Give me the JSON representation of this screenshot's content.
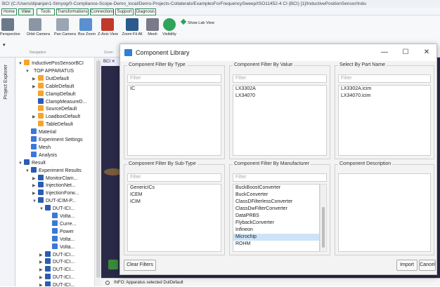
{
  "window_title": "BCI (C:/Users/dipanjan1-Simyog/0-Compliance-Scope-Demo_local/Demo-Projects-Collaterals/ExamplesForFrequencySweep/ISO11452-4 CI (BCI) [1]/InductivePositionSensor/Indu",
  "ribbon_tabs": [
    "Home",
    "View",
    "Tools",
    "Transformations",
    "Connections",
    "Support",
    "Diagnosis"
  ],
  "ribbon_buttons": [
    "Perspective",
    "Orbit Camera",
    "Pan Camera",
    "Box Zoom",
    "Z-Axis View",
    "Zoom Fit All",
    "Mesh",
    "Visibility"
  ],
  "show_lab_view": "Show Lab View",
  "ribbon_sections": {
    "navigation": "Navigation",
    "zoom": "Zoom"
  },
  "left_strip_label": "Project Explorer",
  "tree": [
    {
      "label": "InductivePosSensorBCI",
      "toggle": "▼",
      "icon": "iP"
    },
    {
      "label": "TOP APPARATUS",
      "toggle": "▼",
      "icon": ""
    },
    {
      "label": "DutDefault",
      "toggle": "▶",
      "icon": "iP"
    },
    {
      "label": "CableDefault",
      "toggle": "▶",
      "icon": "iP"
    },
    {
      "label": "ClampDefault",
      "toggle": "",
      "icon": "iP"
    },
    {
      "label": "ClampMeasureD...",
      "toggle": "",
      "icon": "iD"
    },
    {
      "label": "SourceDefault",
      "toggle": "",
      "icon": "iP"
    },
    {
      "label": "LoadboxDefault",
      "toggle": "▶",
      "icon": "iP"
    },
    {
      "label": "TableDefault",
      "toggle": "",
      "icon": "iP"
    },
    {
      "label": "Material",
      "toggle": "",
      "icon": "iV"
    },
    {
      "label": "Experiment Settings",
      "toggle": "",
      "icon": "iV"
    },
    {
      "label": "Mesh",
      "toggle": "",
      "icon": "iV"
    },
    {
      "label": "Analysis",
      "toggle": "",
      "icon": "iV"
    },
    {
      "label": "Result",
      "toggle": "▼",
      "icon": "iR"
    },
    {
      "label": "Experiment Results",
      "toggle": "▼",
      "icon": "iR"
    },
    {
      "label": "MonitorClam...",
      "toggle": "▶",
      "icon": "iR"
    },
    {
      "label": "InjectionNet...",
      "toggle": "▶",
      "icon": "iR"
    },
    {
      "label": "InjectionForw...",
      "toggle": "▶",
      "icon": "iR"
    },
    {
      "label": "DUT-ICIM-P...",
      "toggle": "▼",
      "icon": "iR"
    },
    {
      "label": "DUT-ICI...",
      "toggle": "▼",
      "icon": "iR"
    },
    {
      "label": "Volta...",
      "toggle": "",
      "icon": "iV"
    },
    {
      "label": "Curre...",
      "toggle": "",
      "icon": "iV"
    },
    {
      "label": "Power",
      "toggle": "",
      "icon": "iV"
    },
    {
      "label": "Volta...",
      "toggle": "",
      "icon": "iV"
    },
    {
      "label": "Volta...",
      "toggle": "",
      "icon": "iV"
    },
    {
      "label": "DUT-ICI...",
      "toggle": "▶",
      "icon": "iR"
    },
    {
      "label": "DUT-ICI...",
      "toggle": "▶",
      "icon": "iR"
    },
    {
      "label": "DUT-ICI...",
      "toggle": "▶",
      "icon": "iR"
    },
    {
      "label": "DUT-ICI...",
      "toggle": "▶",
      "icon": "iR"
    },
    {
      "label": "DUT-ICI...",
      "toggle": "▶",
      "icon": "iR"
    }
  ],
  "canvas_tab": "BCI",
  "status_text": "INFO: Apparatus selected DutDefault",
  "dialog": {
    "title": "Component Library",
    "minimize": "—",
    "maximize": "☐",
    "close": "✕",
    "filter_placeholder": "Filter",
    "filter_by_type": {
      "label": "Component Filter By Type",
      "items": [
        "IC"
      ]
    },
    "filter_by_value": {
      "label": "Component Filter By Value",
      "items": [
        "LX3302A",
        "LX34070"
      ]
    },
    "select_by_part": {
      "label": "Select By Part Name",
      "items": [
        "LX3302A.icim",
        "LX34070.icim"
      ]
    },
    "filter_by_subtype": {
      "label": "Component Filter By Sub-Type",
      "items": [
        "GenericICs",
        "ICEM",
        "ICIM"
      ]
    },
    "filter_by_manufacturer": {
      "label": "Component Filter By Manufacturer",
      "items": [
        "BuckBoostConverter",
        "BuckConverter",
        "ClassDFilterlessConverter",
        "ClassDwFilterConverter",
        "DataPRBS",
        "FlybackConverter",
        "Infineon",
        "Microchip",
        "ROHM"
      ],
      "selected": "Microchip"
    },
    "description": {
      "label": "Component Description"
    },
    "clear_filters": "Clear Filters",
    "import": "Import",
    "cancel": "Cancel"
  }
}
